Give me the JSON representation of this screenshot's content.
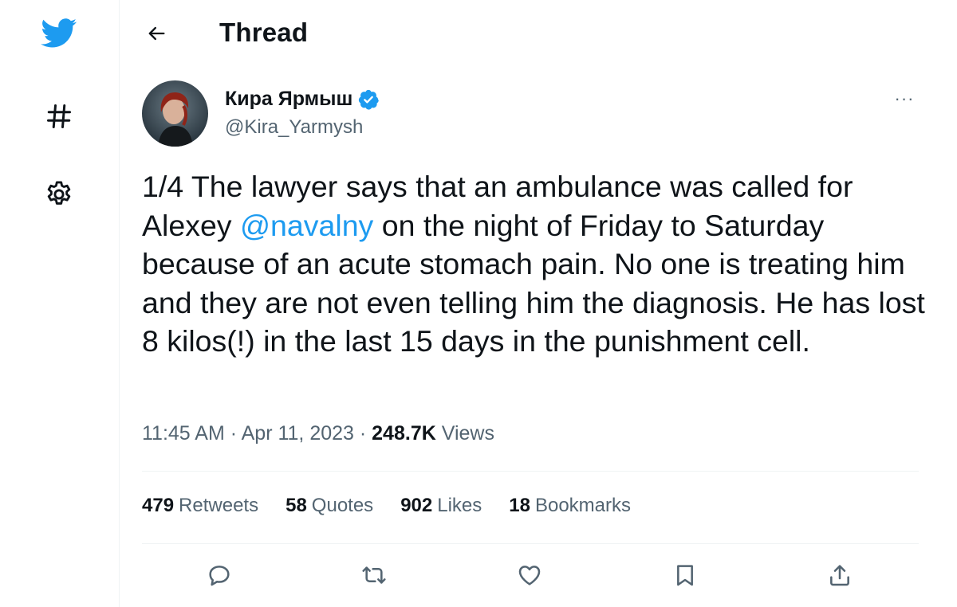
{
  "colors": {
    "brand": "#1d9bf0",
    "text_primary": "#0f1419",
    "text_secondary": "#536471",
    "divider": "#eff3f4"
  },
  "sidebar": {
    "items": [
      {
        "icon": "twitter-bird-icon"
      },
      {
        "icon": "hashtag-icon"
      },
      {
        "icon": "gear-icon"
      }
    ]
  },
  "header": {
    "back_icon": "arrow-left-icon",
    "title": "Thread"
  },
  "tweet": {
    "author": {
      "name": "Кира Ярмыш",
      "handle": "@Kira_Yarmysh",
      "verified": true
    },
    "more_label": "···",
    "text": {
      "before_mention": "1/4 The lawyer says that an ambulance was called for Alexey ",
      "mention": "@navalny",
      "after_mention": " on the night of Friday to Saturday because of an acute stomach pain. No one is treating him and they are not even telling him the diagnosis. He has lost 8 kilos(!) in the last 15 days in the punishment cell."
    },
    "time": "11:45 AM",
    "separator": " · ",
    "date": "Apr 11, 2023",
    "views_count": "248.7K",
    "views_label": "Views",
    "stats": [
      {
        "count": "479",
        "label": "Retweets"
      },
      {
        "count": "58",
        "label": "Quotes"
      },
      {
        "count": "902",
        "label": "Likes"
      },
      {
        "count": "18",
        "label": "Bookmarks"
      }
    ],
    "actions": [
      "reply-icon",
      "retweet-icon",
      "like-icon",
      "bookmark-icon",
      "share-icon"
    ]
  }
}
